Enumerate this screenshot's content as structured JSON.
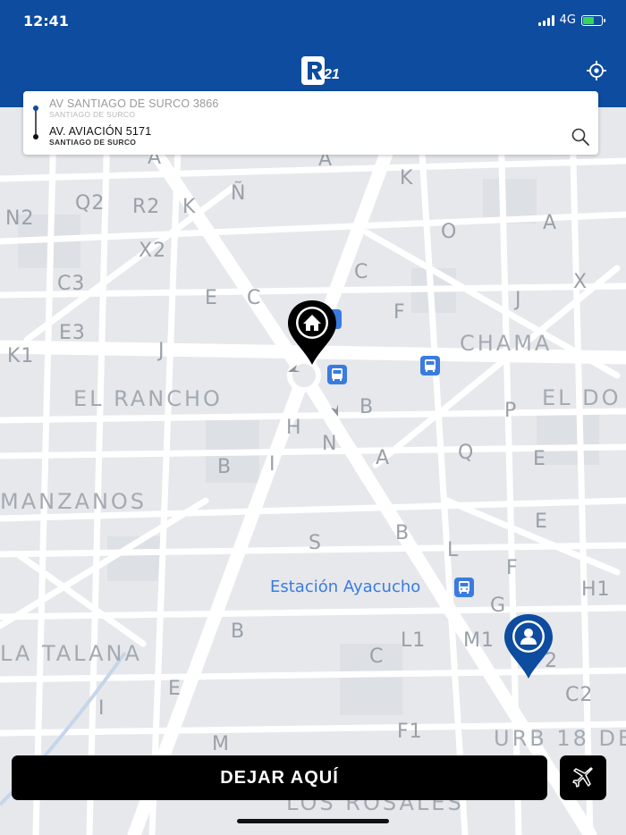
{
  "status": {
    "time": "12:41",
    "network": "4G"
  },
  "route": {
    "origin": {
      "address": "AV SANTIAGO DE SURCO 3866",
      "district": "SANTIAGO DE SURCO"
    },
    "destination": {
      "address": "AV. AVIACIÓN 5171",
      "district": "SANTIAGO DE SURCO"
    }
  },
  "map": {
    "labels": [
      "N2",
      "Q2",
      "R2",
      "K",
      "Ñ",
      "A",
      "A",
      "K",
      "X2",
      "O",
      "A",
      "C3",
      "E",
      "C",
      "C",
      "F",
      "J",
      "X",
      "E3",
      "K1",
      "J",
      "CHAMA",
      "EL RANCHO",
      "B",
      "EL DO",
      "H",
      "P",
      "N",
      "A",
      "Q",
      "E",
      "B",
      "I",
      "H",
      "MANZANOS",
      "S",
      "B",
      "L",
      "F",
      "H1",
      "E",
      "G",
      "B",
      "LA TALANA",
      "L1",
      "M1",
      "C",
      "2",
      "E",
      "C2",
      "I",
      "F1",
      "URB 18 DE",
      "M",
      "LOS ROSALES"
    ],
    "station": "Estación Ayacucho"
  },
  "actions": {
    "drop_label": "DEJAR AQUÍ"
  },
  "colors": {
    "header": "#0d4c9e",
    "pin_dest": "#000000",
    "pin_user": "#0d4c9e",
    "station_text": "#3a7be0"
  },
  "icons": {
    "home_pin": "home-icon",
    "user_pin": "user-icon",
    "airport": "airplane-icon",
    "search": "search-icon",
    "locate": "locate-icon",
    "bus": "bus-icon"
  }
}
